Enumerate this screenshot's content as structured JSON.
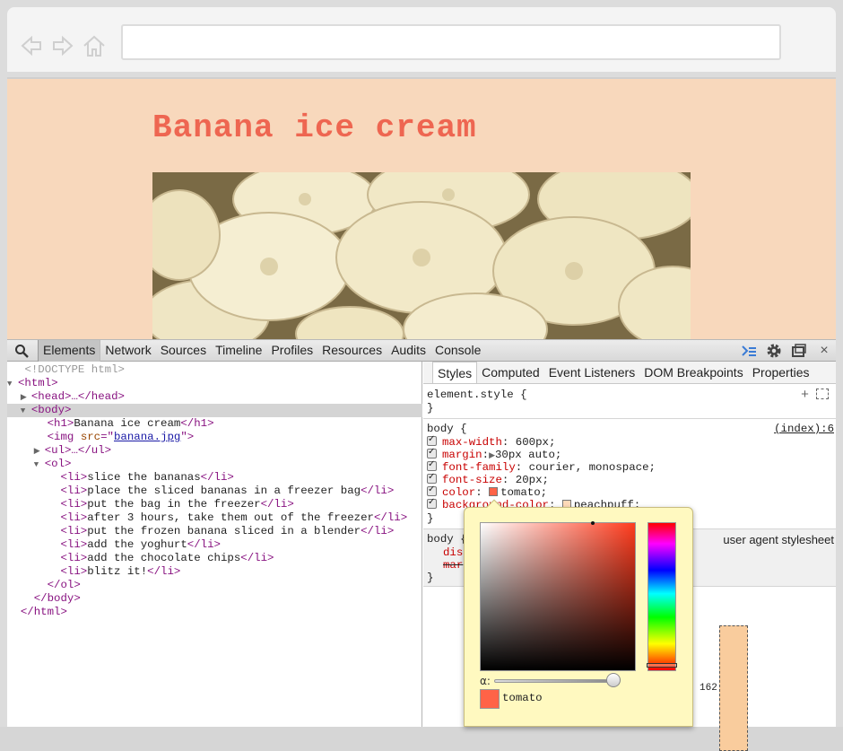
{
  "browser": {
    "url": ""
  },
  "page": {
    "title": "Banana ice cream"
  },
  "devtools": {
    "tabs": [
      {
        "label": "Elements",
        "active": true
      },
      {
        "label": "Network"
      },
      {
        "label": "Sources"
      },
      {
        "label": "Timeline"
      },
      {
        "label": "Profiles"
      },
      {
        "label": "Resources"
      },
      {
        "label": "Audits"
      },
      {
        "label": "Console"
      }
    ],
    "dom": {
      "doctype": "<!DOCTYPE html>",
      "html_open": "<html>",
      "head": "<head>…</head>",
      "body_open": "<body>",
      "h1_open": "<h1>",
      "h1_text": "Banana ice cream",
      "h1_close": "</h1>",
      "img_open": "<img ",
      "img_attr": "src",
      "img_eq": "=\"",
      "img_src": "banana.jpg",
      "img_close": "\">",
      "ul": "<ul>…</ul>",
      "ol_open": "<ol>",
      "li_open": "<li>",
      "li_close": "</li>",
      "items": [
        "slice the bananas",
        "place the sliced bananas in a freezer bag",
        "put the bag in the freezer",
        "after 3 hours, take them out of the freezer",
        "put the frozen banana sliced in a blender",
        "add the yoghurt",
        "add the chocolate chips",
        "blitz it!"
      ],
      "ol_close": "</ol>",
      "body_close": "</body>",
      "html_close": "</html>"
    },
    "styles_tabs": [
      {
        "label": "Styles",
        "active": true
      },
      {
        "label": "Computed"
      },
      {
        "label": "Event Listeners"
      },
      {
        "label": "DOM Breakpoints"
      },
      {
        "label": "Properties"
      }
    ],
    "element_style": {
      "selector": "element.style {",
      "close": "}"
    },
    "body_rule": {
      "selector": "body {",
      "source": "(index):6",
      "props": [
        {
          "name": "max-width",
          "value": "600px;"
        },
        {
          "name": "margin",
          "value": "30px auto;"
        },
        {
          "name": "font-family",
          "value": "courier, monospace;"
        },
        {
          "name": "font-size",
          "value": "20px;"
        },
        {
          "name": "color",
          "value": "tomato;"
        },
        {
          "name": "background-color",
          "value": "peachpuff;"
        }
      ],
      "close": "}"
    },
    "ua_rule": {
      "selector": "body {",
      "source": "user agent stylesheet",
      "prop1": "dis",
      "prop2": "mar",
      "close": "}"
    },
    "box_model_value": "162",
    "color_picker": {
      "alpha_label": "α:",
      "color_name": "tomato",
      "swatch_color": "#ff6347"
    }
  }
}
